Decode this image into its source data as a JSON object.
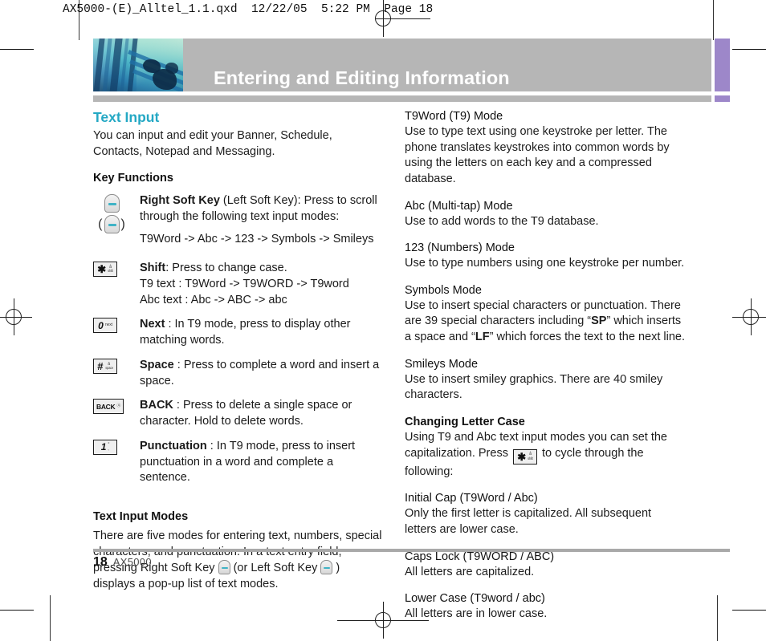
{
  "slug": "AX5000-(E)_Alltel_1.1.qxd  12/22/05  5:22 PM  Page 18",
  "header": {
    "title": "Entering and Editing Information",
    "band_color": "#b6b6b6",
    "accent_color": "#9d87c9",
    "title_color": "#ffffff"
  },
  "left": {
    "section_title": "Text Input",
    "section_title_color": "#24a8c4",
    "intro": "You can input and edit your Banner, Schedule, Contacts, Notepad and Messaging.",
    "key_functions_heading": "Key Functions",
    "key_rows": [
      {
        "icon": "soft-key-pair-icon",
        "bold": "Right Soft Key",
        "text": " (Left Soft Key): Press to scroll through the following text input modes:",
        "extra": "T9Word -> Abc -> 123 -> Symbols -> Smileys"
      },
      {
        "icon": "star-shift-key-icon",
        "key_main": "✱",
        "key_sub_top": "å",
        "key_sub_bottom": "shift",
        "bold": "Shift",
        "text": ": Press to change case.",
        "line2": "T9 text : T9Word -> T9WORD -> T9word",
        "line3": "Abc text : Abc -> ABC -> abc"
      },
      {
        "icon": "zero-next-key-icon",
        "key_main": "0",
        "key_sub_top": "next",
        "key_sub_bottom": "",
        "bold": "Next",
        "text": " : In T9 mode, press to display other matching words."
      },
      {
        "icon": "hash-space-key-icon",
        "key_main": "#",
        "key_sub_top": "â",
        "key_sub_bottom": "space",
        "bold": "Space",
        "text": " : Press to complete a word and insert a space."
      },
      {
        "icon": "back-key-icon",
        "key_main": "BACK",
        "key_sub_top": "ⓠ",
        "key_sub_bottom": "",
        "bold": "BACK",
        "text": " : Press to delete a single space or character. Hold to delete words."
      },
      {
        "icon": "one-punctuation-key-icon",
        "key_main": "1",
        "key_sub_top": "°",
        "key_sub_bottom": ".,",
        "bold": "Punctuation",
        "text": " : In T9 mode, press to insert punctuation in a word and complete a sentence."
      }
    ],
    "modes_heading": "Text Input Modes",
    "modes_text_a": "There are five modes for entering text, numbers, special characters, and punctuation. In a text entry field, pressing Right Soft Key ",
    "modes_text_b": " (or Left Soft Key ",
    "modes_text_c": " ) displays a pop-up list of text modes."
  },
  "right": {
    "blocks": [
      {
        "heading": "T9Word (T9) Mode",
        "body": "Use to type text using one keystroke per letter. The phone translates keystrokes into common words by using the letters on each key and a compressed database.",
        "bold_heading": false
      },
      {
        "heading": "Abc (Multi-tap) Mode",
        "body": "Use to add words to the T9 database.",
        "bold_heading": false
      },
      {
        "heading": "123 (Numbers) Mode",
        "body": "Use to type numbers using one keystroke per number.",
        "bold_heading": false
      },
      {
        "heading": "Symbols Mode",
        "body": "Use to insert special characters or punctuation. There are 39 special characters including “SP” which inserts a space and “LF” which forces the text to the next line.",
        "bold_heading": false,
        "bold_terms": [
          "SP",
          "LF"
        ]
      },
      {
        "heading": "Smileys Mode",
        "body": "Use to insert smiley graphics. There are 40 smiley characters.",
        "bold_heading": false
      }
    ],
    "case_heading": "Changing Letter Case",
    "case_intro_a": "Using T9 and Abc text input modes you can set the capitalization. Press ",
    "case_intro_b": " to cycle through the following:",
    "case_items": [
      {
        "heading": "Initial Cap (T9Word / Abc)",
        "body": "Only the first letter is capitalized. All subsequent letters are lower case.",
        "small": true
      },
      {
        "heading": "Caps Lock (T9WORD / ABC)",
        "body": "All letters are capitalized.",
        "small": false
      },
      {
        "heading": "Lower Case (T9word / abc)",
        "body": "All letters are in lower case.",
        "small": false
      }
    ]
  },
  "footer": {
    "page_number": "18",
    "model": "AX5000"
  }
}
